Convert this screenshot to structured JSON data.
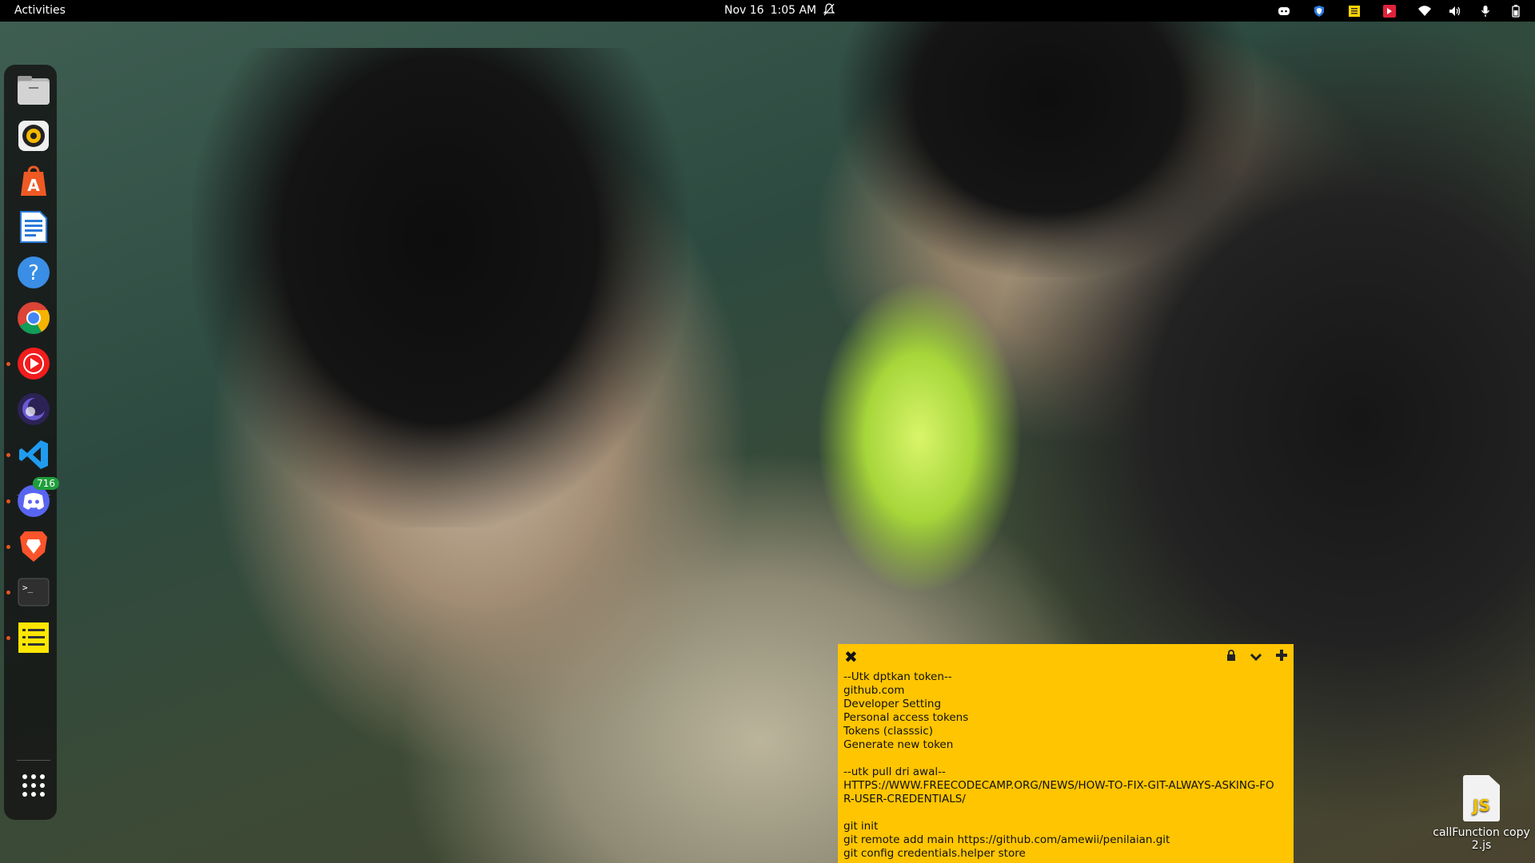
{
  "topbar": {
    "activities": "Activities",
    "date": "Nov 16",
    "time": "1:05 AM"
  },
  "dock": {
    "items": [
      {
        "name": "files"
      },
      {
        "name": "rhythmbox"
      },
      {
        "name": "app-center"
      },
      {
        "name": "libreoffice-writer"
      },
      {
        "name": "help"
      },
      {
        "name": "chrome"
      },
      {
        "name": "youtube-music"
      },
      {
        "name": "eclipse"
      },
      {
        "name": "vscode"
      },
      {
        "name": "discord",
        "badge": "716"
      },
      {
        "name": "brave"
      },
      {
        "name": "terminal"
      },
      {
        "name": "sticky-notes"
      },
      {
        "name": "show-apps"
      }
    ]
  },
  "sticky_note": {
    "text": "--Utk dptkan token--\ngithub.com\nDeveloper Setting\nPersonal access tokens\nTokens (classsic)\nGenerate new token\n\n--utk pull dri awal--\nHTTPS://WWW.FREECODECAMP.ORG/NEWS/HOW-TO-FIX-GIT-ALWAYS-ASKING-FOR-USER-CREDENTIALS/\n\ngit init\ngit remote add main https://github.com/amewii/penilaian.git\ngit config credentials.helper store"
  },
  "desktop": {
    "file_name": "callFunction copy 2.js",
    "file_icon_label": "JS"
  },
  "colors": {
    "note_bg": "#ffc500",
    "accent": "#e95420"
  }
}
